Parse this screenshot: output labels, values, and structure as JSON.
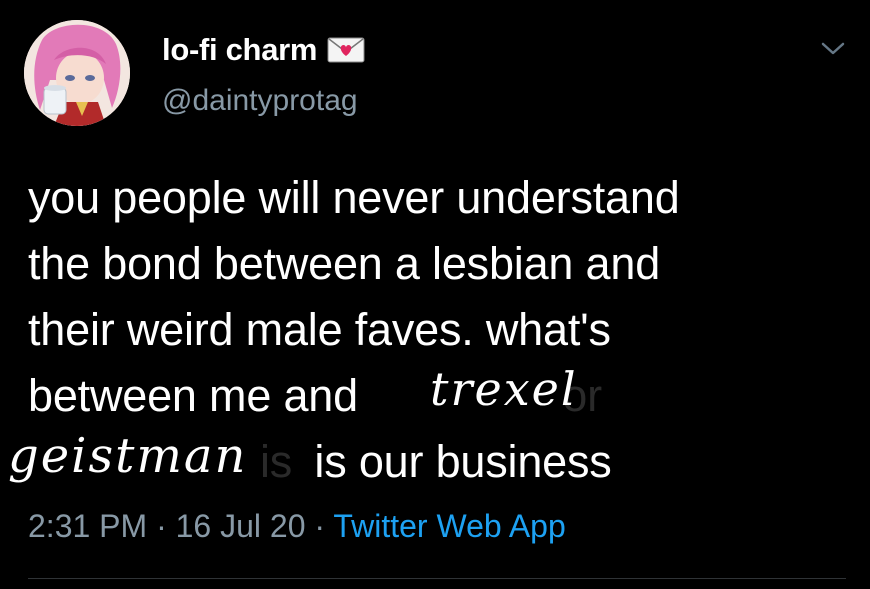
{
  "user": {
    "display_name": "lo-fi charm",
    "handle": "@daintyprotag",
    "name_badge_icon": "love-letter-icon"
  },
  "tweet": {
    "lines": [
      "you people will never understand",
      "the bond between a lesbian and",
      "their weird male faves. what's",
      "between me and",
      "is our business"
    ],
    "faded_fragment_1": "or",
    "faded_fragment_2": "is",
    "handwritten_1": "trexel",
    "handwritten_2": "geistman"
  },
  "meta": {
    "time": "2:31 PM",
    "separator": "·",
    "date": "16 Jul 20",
    "source": "Twitter Web App"
  },
  "colors": {
    "background": "#000000",
    "text": "#ffffff",
    "secondary": "#8899a6",
    "link": "#1da1f2"
  },
  "icons": {
    "menu": "chevron-down-icon",
    "avatar": "avatar"
  }
}
